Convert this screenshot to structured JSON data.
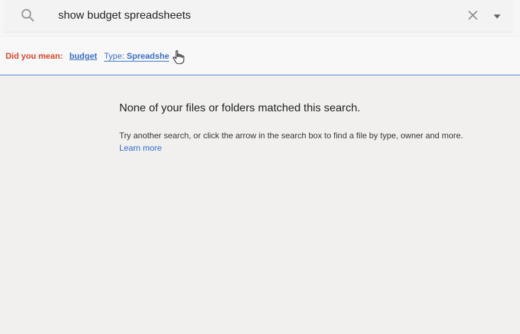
{
  "search": {
    "query": "show budget spreadsheets",
    "icons": {
      "search": "search-icon",
      "clear": "close-icon",
      "options": "caret-down-icon"
    }
  },
  "suggestion": {
    "prefix": "Did you mean:",
    "term": "budget",
    "type_label": "Type:",
    "type_value": "Spreadshe",
    "colors": {
      "prefix": "#d9452f",
      "link": "#3a6fc4"
    }
  },
  "empty_state": {
    "title": "None of your files or folders matched this search.",
    "description": "Try another search, or click the arrow in the search box to find a file by type, owner and more.",
    "learn_more": "Learn more"
  }
}
